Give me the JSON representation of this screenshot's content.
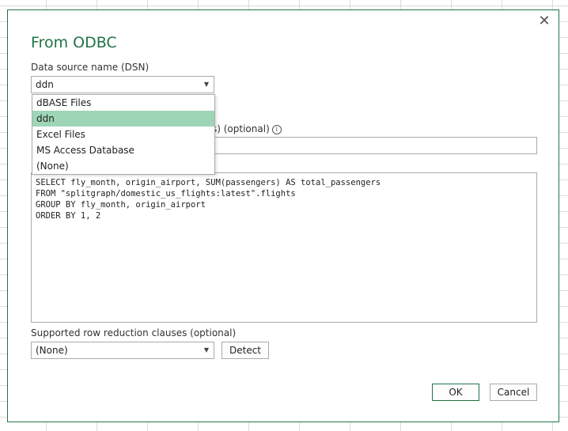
{
  "dialog": {
    "title": "From ODBC",
    "close_icon": "✕"
  },
  "dsn": {
    "label": "Data source name (DSN)",
    "value": "ddn",
    "options": [
      "dBASE Files",
      "ddn",
      "Excel Files",
      "MS Access Database",
      "(None)"
    ],
    "selected_option": "ddn"
  },
  "connection": {
    "label_visible_part": "s) (optional)",
    "value": ""
  },
  "sql": {
    "lines": [
      "SELECT fly_month, origin_airport, SUM(passengers) AS total_passengers",
      "FROM \"splitgraph/domestic_us_flights:latest\".flights",
      "GROUP BY fly_month, origin_airport",
      "ORDER BY 1, 2"
    ]
  },
  "row_reduction": {
    "label": "Supported row reduction clauses (optional)",
    "value": "(None)",
    "detect_label": "Detect"
  },
  "footer": {
    "ok_label": "OK",
    "cancel_label": "Cancel"
  },
  "colors": {
    "accent": "#217346",
    "selected_option_bg": "#9fd5b7"
  }
}
